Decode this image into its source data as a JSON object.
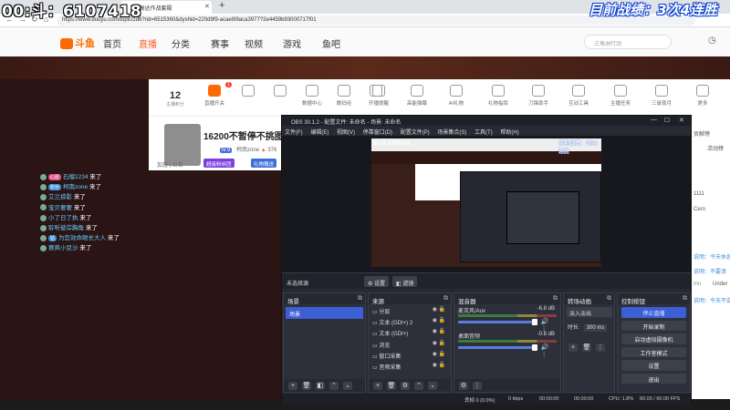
{
  "overlay": {
    "stream_id": "00:斗：6107418",
    "top_right": "目前战绩：3次4连胜"
  },
  "browser": {
    "tab_title": "【J]高达作战套殿",
    "url": "https://www.douyu.com/topic/zd6?rid=6515360&dyshid=220d9f9-acaei99aca3977?2e4459b93000717f01",
    "new_tab": "+",
    "window_min": "—",
    "window_max": "☐",
    "window_close": "✕"
  },
  "site_nav": {
    "logo": "斗鱼",
    "items": [
      "首页",
      "直播",
      "分类",
      "赛事",
      "视频",
      "游戏",
      "鱼吧"
    ],
    "search_placeholder": "三角洲行动",
    "right_label": "历史"
  },
  "toolbar": {
    "followers": "12",
    "followers_label": "主播积分",
    "badge": "1",
    "tools": [
      "直播开关",
      "",
      "",
      "数据中心",
      "数码经",
      "",
      "开播提醒",
      "高能弹幕",
      "AI礼物",
      "礼物指挥",
      "刀锋助手",
      "互动工具",
      "主播任务",
      "三鼠夜月",
      "更多"
    ]
  },
  "room": {
    "title": "16200不暂停不挑图选-",
    "level": "lv 9",
    "streamer": "柯南zone",
    "hot": "376",
    "under_avatar": "加班 | 公告",
    "pills": [
      {
        "label": "超级粉丝团",
        "color": "#7b3fe4"
      },
      {
        "label": "礼物赠送",
        "color": "#3c6fd8"
      }
    ]
  },
  "chat": [
    {
      "tag": "心愿",
      "tag_color": "#e0508a",
      "name": "石榴1234",
      "msg": "来了"
    },
    {
      "tag": "粉丝",
      "tag_color": "#3c8fd8",
      "name": "柯南zone",
      "msg": "来了"
    },
    {
      "tag": "",
      "tag_color": "",
      "name": "艾兰掠影",
      "msg": "来了"
    },
    {
      "tag": "",
      "tag_color": "",
      "name": "宝贝奢奢",
      "msg": "来了"
    },
    {
      "tag": "",
      "tag_color": "",
      "name": "小了日了执",
      "msg": "来了"
    },
    {
      "tag": "",
      "tag_color": "",
      "name": "聆听彼岸胸角",
      "msg": "来了"
    },
    {
      "tag": "钻",
      "tag_color": "#3c8fd8",
      "name": "为您效命眼长大人",
      "msg": "来了"
    },
    {
      "tag": "",
      "tag_color": "",
      "name": "赛爽小豆沙",
      "msg": "来了"
    }
  ],
  "right_panel": {
    "items": [
      "贡献榜",
      "活动榜",
      "1111",
      "Cero",
      "说明：今天休息",
      "说明：不要浪",
      "Inn",
      "Under",
      "说明：今天不会"
    ]
  },
  "obs": {
    "title": "OBS 30.1.2 - 配置文件: 未命名 - 场景: 未命名",
    "menu": [
      "文件(F)",
      "编辑(E)",
      "视图(V)",
      "停靠窗口(D)",
      "配置文件(P)",
      "场景集合(S)",
      "工具(T)",
      "帮助(H)"
    ],
    "preview_overlay_left": "00:斗:6107418",
    "preview_overlay_right": "目前战绩：3次4连胜",
    "no_source_label": "未选择源",
    "props_button": "设置",
    "filters_button": "滤镜",
    "scenes": {
      "title": "场景",
      "items": [
        "场景"
      ]
    },
    "sources": {
      "title": "来源",
      "items": [
        "分层",
        "文本 (GDI+) 2",
        "文本 (GDI+)",
        "浏览",
        "窗口采集",
        "音频采集"
      ]
    },
    "mixer": {
      "title": "混音器",
      "channels": [
        {
          "name": "麦克风/Aux",
          "db": "-6.8 dB",
          "level": 0.78
        },
        {
          "name": "桌面音频",
          "db": "-0.8 dB",
          "level": 0.78
        }
      ]
    },
    "transitions": {
      "title": "转场动画",
      "type": "淡入淡出",
      "duration_label": "时长",
      "duration": "300 ms"
    },
    "controls": {
      "title": "控制按钮",
      "buttons": [
        "停止直播",
        "开始录制",
        "启动虚拟摄像机",
        "工作室模式",
        "设置",
        "退出"
      ]
    },
    "status": {
      "dropped": "丢帧 0 (0.0%)",
      "bitrate": "0 kbps",
      "stream_time": "00:00:00",
      "rec_time": "00:00:00",
      "cpu": "CPU: 1.8%",
      "fps": "60.00 / 60.00 FPS"
    }
  }
}
